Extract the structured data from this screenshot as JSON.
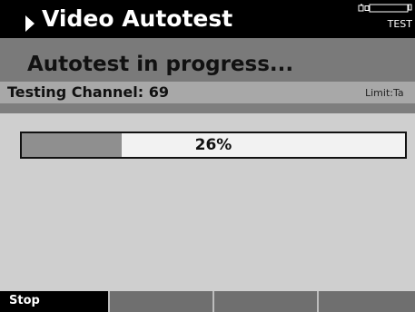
{
  "header": {
    "title": "Video Autotest",
    "mode": "TEST"
  },
  "status": {
    "heading": "Autotest in progress...",
    "channel_text": "Testing Channel: 69",
    "limit_text": "Limit:Ta"
  },
  "progress": {
    "percent": 26,
    "label": "26%"
  },
  "softkeys": [
    {
      "label": "Stop"
    },
    {
      "label": ""
    },
    {
      "label": ""
    },
    {
      "label": ""
    }
  ],
  "colors": {
    "title_bg": "#000000",
    "band_gray": "#7a7a7a",
    "progress_fill": "#8f8f8f",
    "softkey_gray": "#6f6f6f"
  }
}
